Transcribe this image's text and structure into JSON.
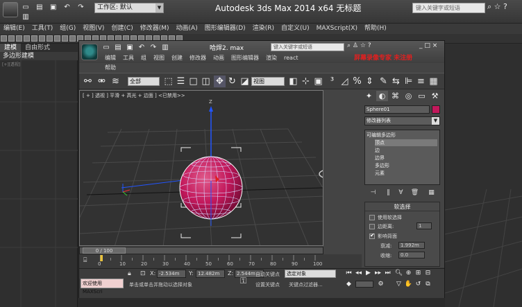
{
  "outer": {
    "title": "Autodesk 3ds Max  2014 x64     无标题",
    "workspace": "工作区: 默认",
    "search_placeholder": "键入关键字或短语",
    "menus": [
      "编辑(E)",
      "工具(T)",
      "组(G)",
      "视图(V)",
      "创建(C)",
      "修改器(M)",
      "动画(A)",
      "图形编辑器(D)",
      "渲染(R)",
      "自定义(U)",
      "MAXScript(X)",
      "帮助(H)"
    ],
    "ribbon_tabs": [
      "建模",
      "自由形式"
    ],
    "ribbon_sub": "多边形建模",
    "left_vp_label": "[+][透视]"
  },
  "inner": {
    "title": "哈焊2. max",
    "search_placeholder": "键入关键字或短语",
    "watermark": "屏幕录像专家 未注册",
    "menus": [
      "编辑",
      "工具",
      "组",
      "视图",
      "创建",
      "修改器",
      "动画",
      "图形编辑器",
      "渲染",
      "react"
    ],
    "menu_help": "帮助",
    "selection_filter": "全部",
    "ref_coord": "视图"
  },
  "viewport": {
    "label": "[ + ] 透视 ] 平滑 + 高光 + 边面 ] <已禁用>>",
    "sphere_color": "#c2185b"
  },
  "timeline": {
    "frame_display": "0 / 100",
    "ticks": [
      "0",
      "10",
      "20",
      "30",
      "40",
      "50",
      "60",
      "70",
      "80",
      "90",
      "100"
    ]
  },
  "status": {
    "maxscript": "欢迎使用 MAXScri",
    "x_label": "X:",
    "x_value": "-2.534m",
    "y_label": "Y:",
    "y_value": "12.482m",
    "z_label": "Z:",
    "z_value": "2.544m",
    "prompt": "单击或单击并拖动以选择对象",
    "autokey": "自动关键点",
    "selected_obj": "选定对象",
    "setkey": "设置关键点",
    "keyfilter": "关键点过滤器..."
  },
  "command_panel": {
    "object_name": "Sphere01",
    "object_color": "#c2185b",
    "modifier_list": "修改器列表",
    "stack": [
      "可编辑多边形",
      "顶点",
      "边",
      "边界",
      "多边形",
      "元素"
    ],
    "stack_selected": 1,
    "rollout_title": "软选择",
    "use_soft": "使用软选择",
    "edge_distance": "边距离:",
    "edge_distance_value": "1",
    "affect_back": "影响背面",
    "falloff_label": "衰减:",
    "falloff_value": "1.992m",
    "pinch_label": "收缩:",
    "pinch_value": "0.0"
  }
}
